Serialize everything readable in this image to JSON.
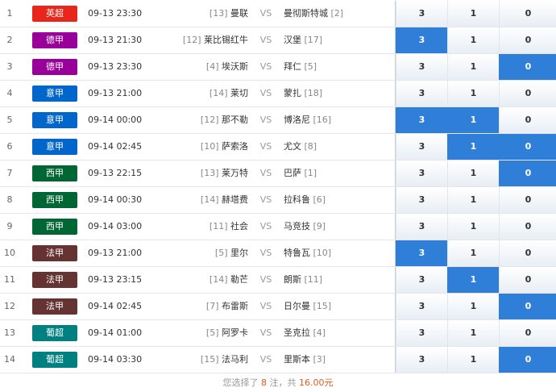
{
  "rows": [
    {
      "num": "1",
      "league": "英超",
      "color": "#e8261b",
      "time": "09-13 23:30",
      "home_rank": "[13]",
      "home": "曼联",
      "vs": "VS",
      "away": "曼彻斯特城",
      "away_rank": "[2]",
      "odds": [
        "3",
        "1",
        "0"
      ],
      "selected": [
        false,
        false,
        false
      ]
    },
    {
      "num": "2",
      "league": "德甲",
      "color": "#990099",
      "time": "09-13 21:30",
      "home_rank": "[12]",
      "home": "莱比锡红牛",
      "vs": "VS",
      "away": "汉堡",
      "away_rank": "[17]",
      "odds": [
        "3",
        "1",
        "0"
      ],
      "selected": [
        true,
        false,
        false
      ]
    },
    {
      "num": "3",
      "league": "德甲",
      "color": "#990099",
      "time": "09-13 23:30",
      "home_rank": "[4]",
      "home": "埃沃斯",
      "vs": "VS",
      "away": "拜仁",
      "away_rank": "[5]",
      "odds": [
        "3",
        "1",
        "0"
      ],
      "selected": [
        false,
        false,
        true
      ]
    },
    {
      "num": "4",
      "league": "意甲",
      "color": "#0066cc",
      "time": "09-13 21:00",
      "home_rank": "[14]",
      "home": "莱切",
      "vs": "VS",
      "away": "蒙扎",
      "away_rank": "[18]",
      "odds": [
        "3",
        "1",
        "0"
      ],
      "selected": [
        false,
        false,
        false
      ]
    },
    {
      "num": "5",
      "league": "意甲",
      "color": "#0066cc",
      "time": "09-14 00:00",
      "home_rank": "[12]",
      "home": "那不勒",
      "vs": "VS",
      "away": "博洛尼",
      "away_rank": "[16]",
      "odds": [
        "3",
        "1",
        "0"
      ],
      "selected": [
        true,
        true,
        false
      ]
    },
    {
      "num": "6",
      "league": "意甲",
      "color": "#0066cc",
      "time": "09-14 02:45",
      "home_rank": "[10]",
      "home": "萨索洛",
      "vs": "VS",
      "away": "尤文",
      "away_rank": "[8]",
      "odds": [
        "3",
        "1",
        "0"
      ],
      "selected": [
        false,
        true,
        true
      ]
    },
    {
      "num": "7",
      "league": "西甲",
      "color": "#006633",
      "time": "09-13 22:15",
      "home_rank": "[13]",
      "home": "莱万特",
      "vs": "VS",
      "away": "巴萨",
      "away_rank": "[1]",
      "odds": [
        "3",
        "1",
        "0"
      ],
      "selected": [
        false,
        false,
        true
      ]
    },
    {
      "num": "8",
      "league": "西甲",
      "color": "#006633",
      "time": "09-14 00:30",
      "home_rank": "[14]",
      "home": "赫塔费",
      "vs": "VS",
      "away": "拉科鲁",
      "away_rank": "[6]",
      "odds": [
        "3",
        "1",
        "0"
      ],
      "selected": [
        false,
        false,
        false
      ]
    },
    {
      "num": "9",
      "league": "西甲",
      "color": "#006633",
      "time": "09-14 03:00",
      "home_rank": "[11]",
      "home": "社会",
      "vs": "VS",
      "away": "马竞技",
      "away_rank": "[9]",
      "odds": [
        "3",
        "1",
        "0"
      ],
      "selected": [
        false,
        false,
        false
      ]
    },
    {
      "num": "10",
      "league": "法甲",
      "color": "#663333",
      "time": "09-13 21:00",
      "home_rank": "[5]",
      "home": "里尔",
      "vs": "VS",
      "away": "特鲁瓦",
      "away_rank": "[10]",
      "odds": [
        "3",
        "1",
        "0"
      ],
      "selected": [
        true,
        false,
        false
      ]
    },
    {
      "num": "11",
      "league": "法甲",
      "color": "#663333",
      "time": "09-13 23:15",
      "home_rank": "[14]",
      "home": "勒芒",
      "vs": "VS",
      "away": "朗斯",
      "away_rank": "[11]",
      "odds": [
        "3",
        "1",
        "0"
      ],
      "selected": [
        false,
        true,
        false
      ]
    },
    {
      "num": "12",
      "league": "法甲",
      "color": "#663333",
      "time": "09-14 02:45",
      "home_rank": "[7]",
      "home": "布雷斯",
      "vs": "VS",
      "away": "日尔曼",
      "away_rank": "[15]",
      "odds": [
        "3",
        "1",
        "0"
      ],
      "selected": [
        false,
        false,
        true
      ]
    },
    {
      "num": "13",
      "league": "葡超",
      "color": "#008080",
      "time": "09-14 01:00",
      "home_rank": "[5]",
      "home": "阿罗卡",
      "vs": "VS",
      "away": "圣克拉",
      "away_rank": "[4]",
      "odds": [
        "3",
        "1",
        "0"
      ],
      "selected": [
        false,
        false,
        false
      ]
    },
    {
      "num": "14",
      "league": "葡超",
      "color": "#008080",
      "time": "09-14 03:30",
      "home_rank": "[15]",
      "home": "法马利",
      "vs": "VS",
      "away": "里斯本",
      "away_rank": "[3]",
      "odds": [
        "3",
        "1",
        "0"
      ],
      "selected": [
        false,
        false,
        true
      ]
    }
  ],
  "footer": {
    "prefix": "您选择了",
    "count": "8",
    "mid": "注，共",
    "amount": "16.00元"
  },
  "colors": {
    "selected": "#2f7fd9"
  }
}
